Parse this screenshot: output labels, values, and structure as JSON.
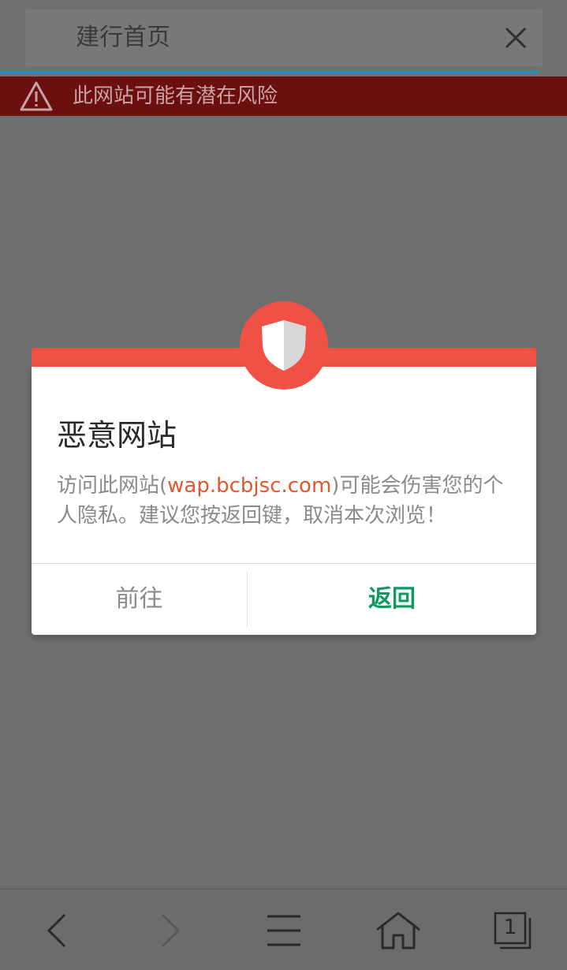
{
  "address_bar": {
    "title": "建行首页"
  },
  "warning_banner": {
    "text": "此网站可能有潜在风险"
  },
  "dialog": {
    "title": "恶意网站",
    "message_prefix": "访问此网站(",
    "url": "wap.bcbjsc.com",
    "message_suffix": ")可能会伤害您的个人隐私。建议您按返回键，取消本次浏览！",
    "proceed_label": "前往",
    "back_label": "返回"
  },
  "bottom_nav": {
    "tab_count": "1"
  },
  "colors": {
    "danger_red": "#ef5244",
    "warning_bar": "#6b0f0f",
    "url_orange": "#e2582c",
    "accent_green": "#0c9b62",
    "overlay_gray": "#6e6e6e"
  },
  "icons": [
    "close-icon",
    "warning-triangle-icon",
    "shield-icon",
    "back-arrow-icon",
    "forward-arrow-icon",
    "menu-icon",
    "home-icon",
    "tabs-icon"
  ]
}
